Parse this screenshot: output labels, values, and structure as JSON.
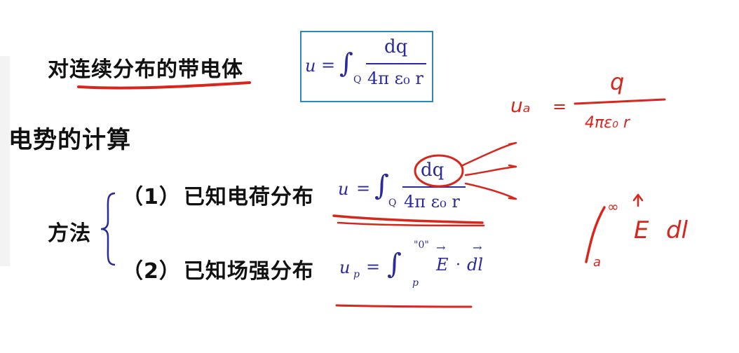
{
  "intro": {
    "text": "对连续分布的带电体"
  },
  "section": {
    "title": "电势的计算"
  },
  "method": {
    "label": "方法"
  },
  "items": [
    {
      "num": "（1）",
      "label": "已知电荷分布"
    },
    {
      "num": "（2）",
      "label": "已知场强分布"
    }
  ],
  "formula_box": {
    "lhs": "u",
    "eq": "=",
    "sub": "Q",
    "num": "dq",
    "den": "4π ε₀ r"
  },
  "formula_1": {
    "lhs": "u",
    "eq": "=",
    "sub": "Q",
    "num": "dq",
    "den": "4π ε₀ r"
  },
  "formula_2": {
    "lhs": "u",
    "lhs_sub": "p",
    "eq": "=",
    "upper": "\"0\"",
    "lower": "p",
    "E": "E",
    "dot": "·",
    "dl": "dl"
  },
  "handwriting": {
    "ua": "uₐ",
    "eq": "=",
    "q": "q",
    "den": "4πε₀ r",
    "int_upper": "∞",
    "int_lower": "a",
    "E": "E",
    "dl": "dl"
  },
  "colors": {
    "ink": "#d8261d",
    "formula": "#2a2a9c",
    "box_border": "#2f86b8"
  }
}
